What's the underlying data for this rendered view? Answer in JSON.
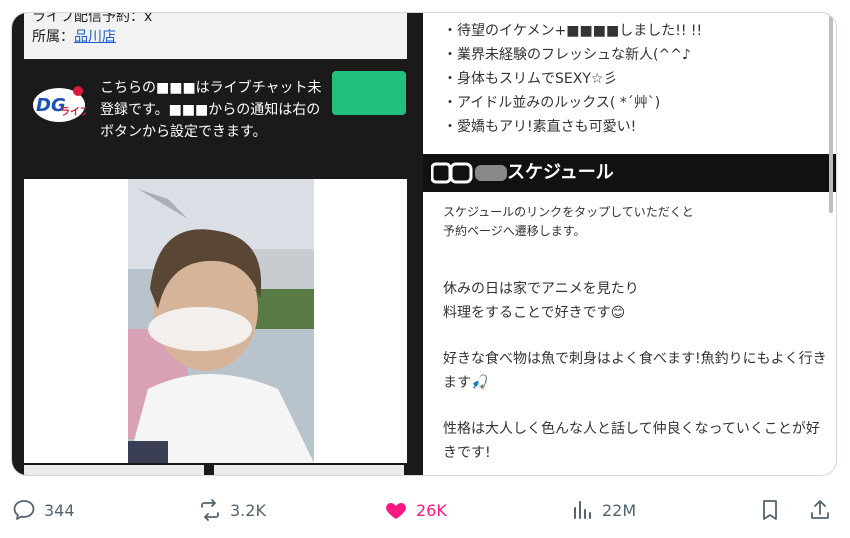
{
  "left": {
    "line1": "ライフ配信予約：x",
    "affiliation_label": "所属：",
    "affiliation_link": "品川店",
    "notification_text": "こちらの■■■はライブチャット未登録です。■■■からの通知は右のボタンから設定できます。"
  },
  "right": {
    "bullets": [
      "・待望のイケメン+■■■■しました!! !!",
      "・業界未経験のフレッシュな新人(^^♪",
      "・身体もスリムでSEXY☆彡",
      "・アイドル並みのルックス( *´艸`)",
      "・愛嬌もアリ!素直さも可愛い!"
    ],
    "schedule_title": "スケジュール",
    "schedule_note_1": "スケジュールのリンクをタップしていただくと",
    "schedule_note_2": "予約ページへ遷移します。",
    "body": [
      "休みの日は家でアニメを見たり",
      "料理をすることで好きです😊",
      "好きな食べ物は魚で刺身はよく食べます!魚釣りにもよく行きます🎣",
      "性格は大人しく色んな人と話して仲良くなっていくことが好きです!"
    ]
  },
  "actions": {
    "replies": "344",
    "reposts": "3.2K",
    "likes": "26K",
    "views": "22M"
  },
  "colors": {
    "like": "#f91880",
    "icon": "#536471",
    "link": "#1a5fd0",
    "green": "#22c07a"
  }
}
